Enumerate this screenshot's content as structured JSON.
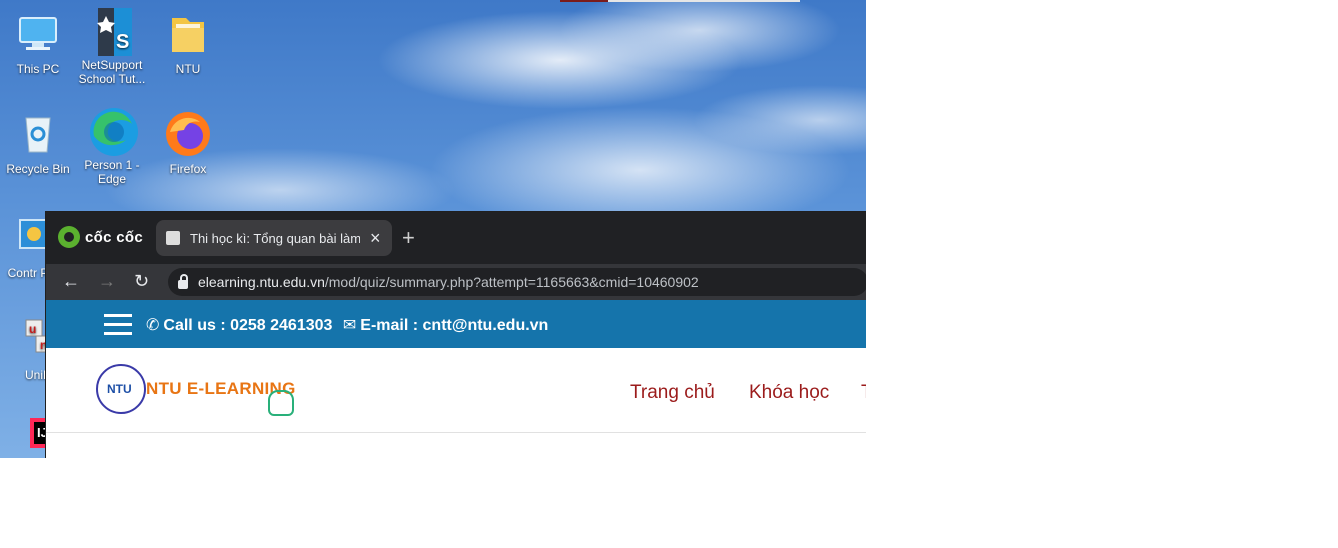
{
  "desktop": {
    "icons": [
      {
        "label": "This PC"
      },
      {
        "label": "NetSupport School Tut..."
      },
      {
        "label": "NTU"
      },
      {
        "label": "Recycle Bin"
      },
      {
        "label": "Person 1 - Edge"
      },
      {
        "label": "Firefox"
      },
      {
        "label": "Contr Pane"
      },
      {
        "label": "UniK"
      }
    ]
  },
  "browser": {
    "brand": "cốc cốc",
    "tab_title": "Thi học kì: Tổng quan bài làm",
    "url_host": "elearning.ntu.edu.vn",
    "url_path": "/mod/quiz/summary.php?attempt=1165663&cmid=10460902"
  },
  "site": {
    "contact_phone": "Call us : 0258 2461303",
    "contact_email": "E-mail : cntt@ntu.edu.vn",
    "brand": "NTU E-LEARNING",
    "nav": [
      {
        "label": "Trang chủ"
      },
      {
        "label": "Khóa học"
      }
    ]
  }
}
